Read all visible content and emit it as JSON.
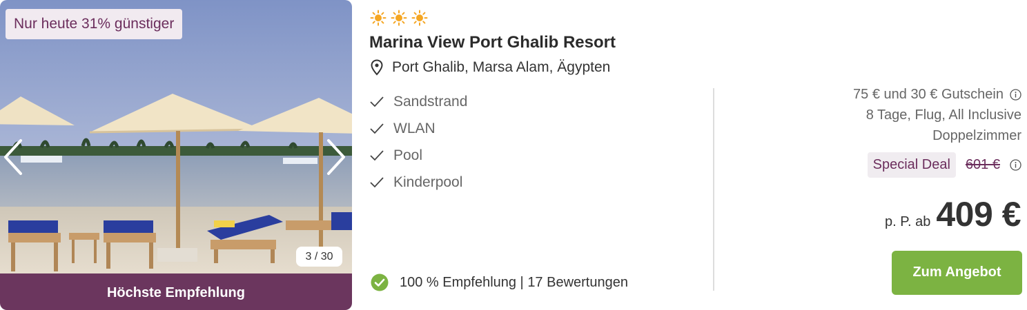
{
  "image_card": {
    "discount_badge": "Nur heute 31% günstiger",
    "counter": "3 / 30",
    "recommendation_label": "Höchste Empfehlung"
  },
  "hotel": {
    "star_rating": 3,
    "name": "Marina View Port Ghalib Resort",
    "location": "Port Ghalib, Marsa Alam, Ägypten",
    "features": [
      "Sandstrand",
      "WLAN",
      "Pool",
      "Kinderpool"
    ],
    "rating_text": "100 % Empfehlung | 17 Bewertungen"
  },
  "offer": {
    "voucher": "75 € und 30 € Gutschein",
    "trip_details": "8 Tage, Flug, All Inclusive",
    "room": "Doppelzimmer",
    "deal_label": "Special Deal",
    "old_price": "601 €",
    "price_prefix": "p. P. ab",
    "price": "409 €",
    "cta_label": "Zum Angebot"
  },
  "colors": {
    "brand_purple": "#6b365e",
    "badge_text": "#6b2d5c",
    "cta_green": "#7cb342",
    "check_green": "#7cb342",
    "star_orange": "#f5a623"
  },
  "icons": {
    "star": "sun-star-icon",
    "location": "map-pin-icon",
    "feature": "checkmark-icon",
    "rating": "check-circle-icon",
    "info": "info-icon",
    "prev": "chevron-left-icon",
    "next": "chevron-right-icon"
  }
}
